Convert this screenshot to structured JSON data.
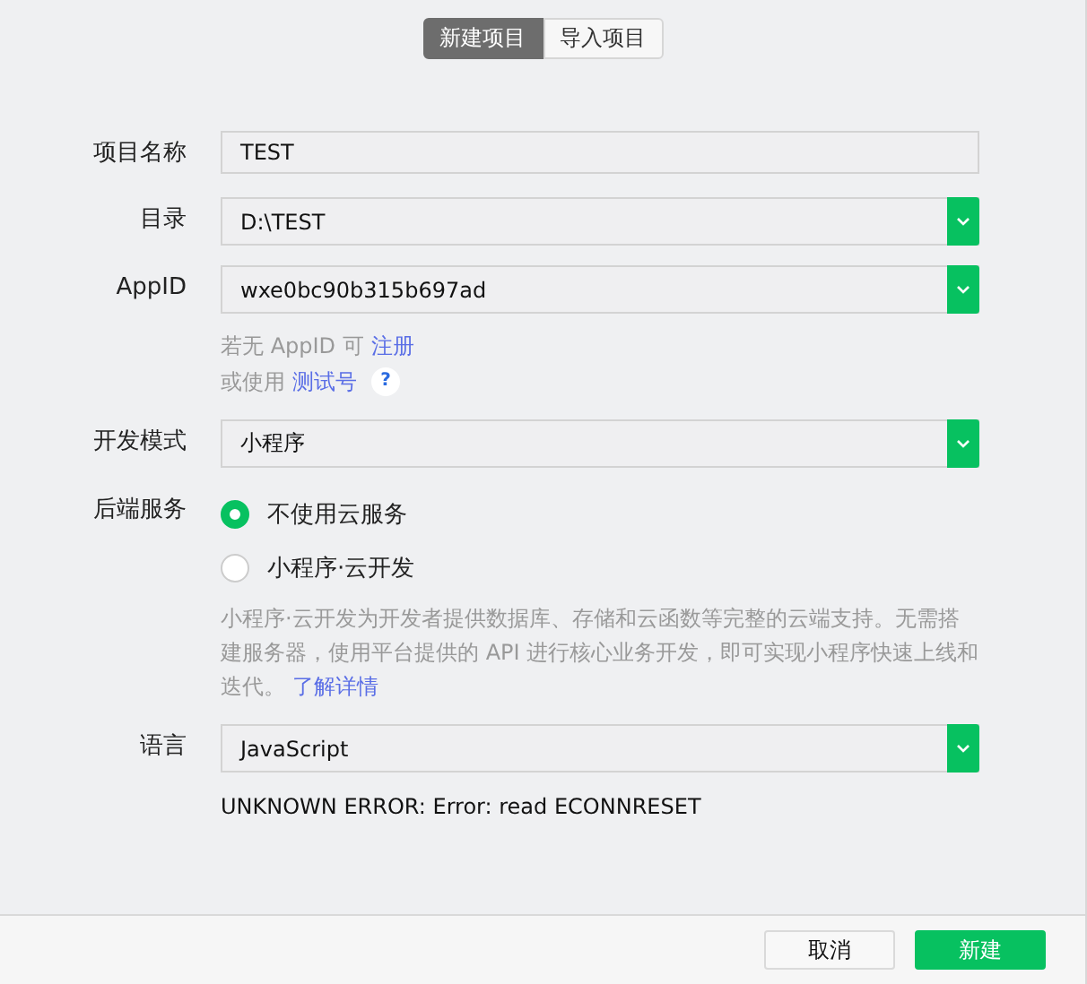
{
  "tabs": [
    {
      "label": "新建项目",
      "selected": true
    },
    {
      "label": "导入项目",
      "selected": false
    }
  ],
  "form": [
    {
      "kind": "text",
      "label": "项目名称",
      "value": "TEST"
    },
    {
      "kind": "select",
      "label": "目录",
      "value": "D:\\TEST"
    },
    {
      "kind": "select",
      "label": "AppID",
      "value": "wxe0bc90b315b697ad",
      "hints": [
        {
          "text": "若无 AppID 可",
          "link": "注册"
        },
        {
          "text": "或使用",
          "link": "测试号",
          "help": "?"
        }
      ]
    },
    {
      "kind": "select",
      "label": "开发模式",
      "value": "小程序"
    },
    {
      "kind": "radio",
      "label": "后端服务",
      "options": [
        {
          "label": "不使用云服务",
          "selected": true
        },
        {
          "label": "小程序·云开发",
          "selected": false
        }
      ],
      "description": "小程序·云开发为开发者提供数据库、存储和云函数等完整的云端支持。无需搭建服务器，使用平台提供的 API 进行核心业务开发，即可实现小程序快速上线和迭代。",
      "link": "了解详情"
    },
    {
      "kind": "select",
      "label": "语言",
      "value": "JavaScript"
    }
  ],
  "error": "UNKNOWN ERROR: Error: read ECONNRESET",
  "buttons": [
    {
      "label": "取消",
      "primary": false
    },
    {
      "label": "新建",
      "primary": true
    }
  ]
}
